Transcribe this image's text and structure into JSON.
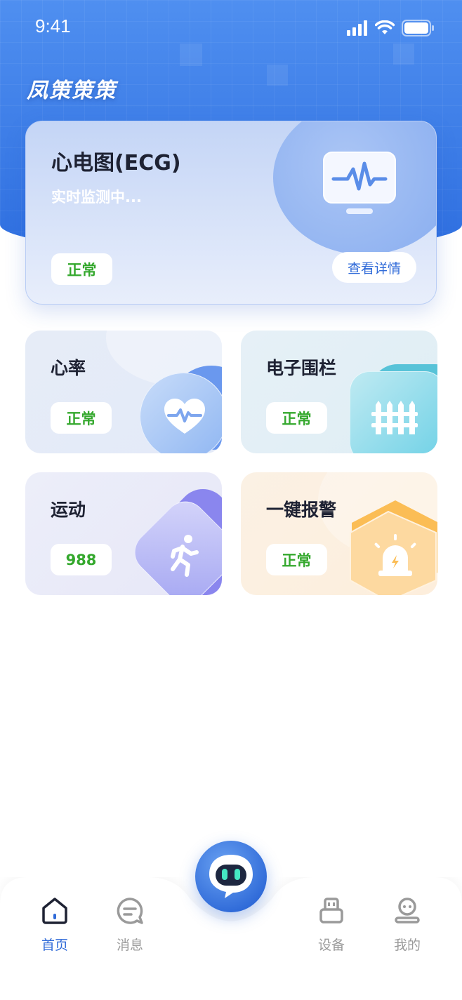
{
  "status_bar": {
    "time": "9:41"
  },
  "header": {
    "app_logo": "凤策策策"
  },
  "ecg_card": {
    "title": "心电图(ECG)",
    "subtitle": "实时监测中...",
    "status": "正常",
    "detail_button": "查看详情"
  },
  "cards": {
    "heart_rate": {
      "title": "心率",
      "status": "正常"
    },
    "fence": {
      "title": "电子围栏",
      "status": "正常"
    },
    "sport": {
      "title": "运动",
      "value": "988"
    },
    "alarm": {
      "title": "一键报警",
      "status": "正常"
    }
  },
  "nav": {
    "home": "首页",
    "messages": "消息",
    "devices": "设备",
    "mine": "我的"
  },
  "colors": {
    "primary": "#2f6ad8",
    "status_green": "#34a82d",
    "inactive": "#9a9a9a"
  },
  "icons": {
    "ecg": "ecg-monitor-icon",
    "heart": "heart-pulse-icon",
    "fence": "fence-icon",
    "sport": "running-icon",
    "alarm": "alarm-siren-icon",
    "assistant": "robot-icon"
  }
}
